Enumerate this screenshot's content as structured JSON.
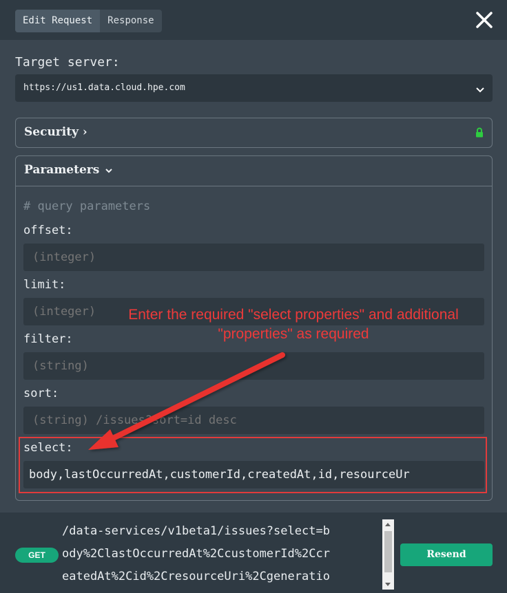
{
  "tabs": [
    {
      "label": "Edit Request",
      "active": true
    },
    {
      "label": "Response",
      "active": false
    }
  ],
  "icons": {
    "close": "close-icon",
    "chevron": "chevron-down-icon",
    "lock": "lock-icon"
  },
  "target_server": {
    "label": "Target server:",
    "value": "https://us1.data.cloud.hpe.com"
  },
  "security": {
    "title": "Security ›",
    "lock_color": "#2ecc40"
  },
  "parameters": {
    "title": "Parameters",
    "comment": "# query parameters",
    "fields": [
      {
        "label": "offset:",
        "placeholder": "(integer)",
        "value": ""
      },
      {
        "label": "limit:",
        "placeholder": "(integer)",
        "value": ""
      },
      {
        "label": "filter:",
        "placeholder": "(string)",
        "value": ""
      },
      {
        "label": "sort:",
        "placeholder": "(string) /issues?sort=id desc",
        "value": ""
      },
      {
        "label": "select:",
        "placeholder": "",
        "value": "body,lastOccurredAt,customerId,createdAt,id,resourceUr"
      }
    ]
  },
  "annotation": {
    "line1": "Enter the required \"select properties\" and additional",
    "line2": "\"properties\" as required",
    "color": "#ee3a3a"
  },
  "footer": {
    "method": "GET",
    "url_lines": [
      "/data-services/v1beta1/issues?select=b",
      "ody%2ClastOccurredAt%2CcustomerId%2Ccr",
      "eatedAt%2Cid%2CresourceUri%2Cgeneratio"
    ],
    "resend_label": "Resend",
    "accent": "#17a67a"
  }
}
